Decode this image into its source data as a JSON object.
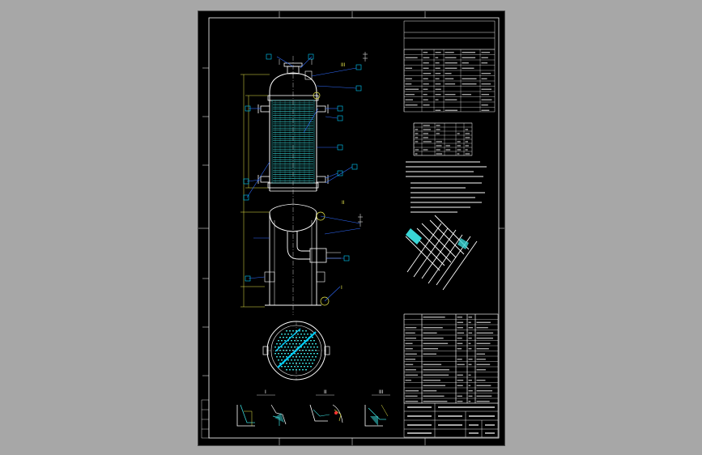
{
  "drawing": {
    "colors": {
      "background": "#a7a7a7",
      "sheet": "#000000",
      "outline": "#ffffff",
      "leader": "#2f6bff",
      "dimension": "#e8e84a",
      "tubes": "#39d6d6",
      "nozzle": "#00d0ff"
    },
    "section_marks": [
      "I",
      "II",
      "III"
    ],
    "detail_labels": [
      "I",
      "II",
      "III"
    ]
  }
}
